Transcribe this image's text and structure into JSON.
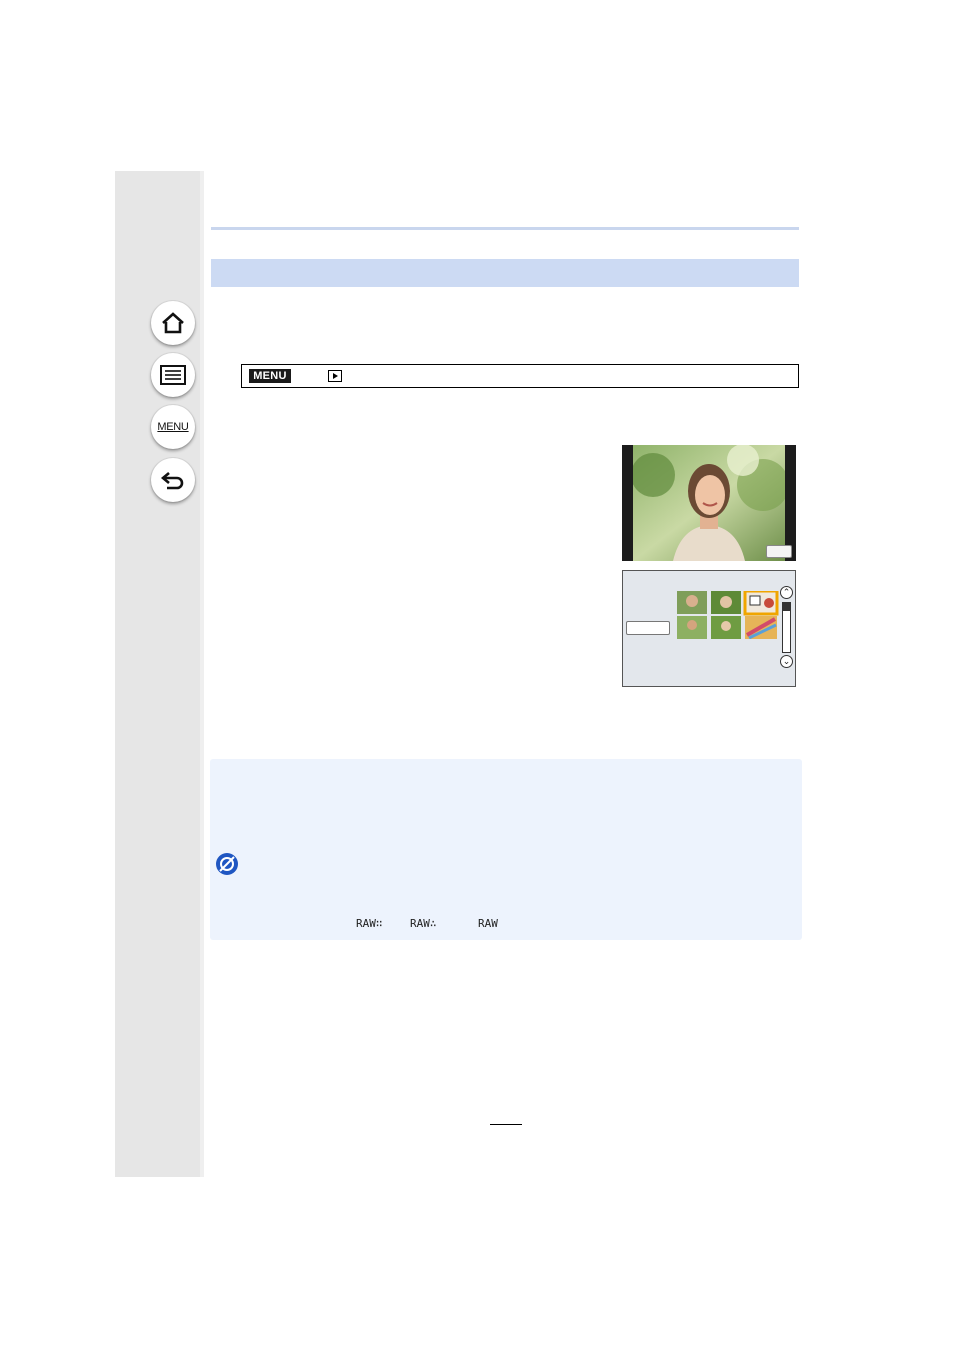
{
  "navigation": {
    "home_icon": "home-icon",
    "contents_icon": "list-icon",
    "menu_label": "MENU",
    "back_icon": "back-arrow-icon"
  },
  "menu_path": {
    "menu_badge": "MENU",
    "playback_icon": "playback-icon"
  },
  "note": {
    "restriction_icon": "not-available-icon",
    "raw_formats": [
      "RAW∷",
      "RAW∴",
      "RAW"
    ]
  },
  "colors": {
    "sidebar": "#e6e6e6",
    "section_bar": "#ccdaf3",
    "note_background": "#edf3fd",
    "restriction_icon": "#1f56c2",
    "selected_thumbnail": "#f0a500"
  }
}
